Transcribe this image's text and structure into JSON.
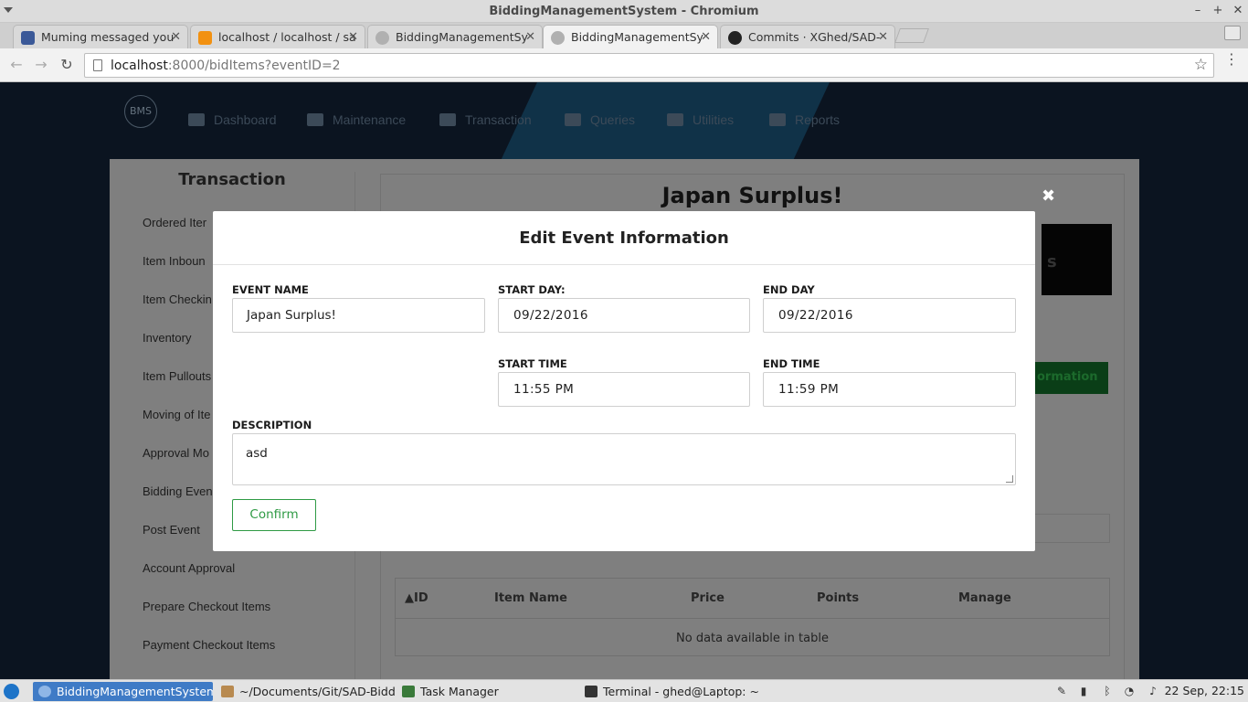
{
  "window": {
    "title": "BiddingManagementSystem - Chromium",
    "minimize": "–",
    "maximize": "+",
    "close": "✕"
  },
  "tabs": [
    {
      "label": "Muming messaged you",
      "icon": "facebook-icon",
      "color": "#3b5998"
    },
    {
      "label": "localhost / localhost / sa",
      "icon": "phpmyadmin-icon",
      "color": "#f29111"
    },
    {
      "label": "BiddingManagementSy",
      "icon": "globe-icon",
      "color": "#9a9a9a"
    },
    {
      "label": "BiddingManagementSy",
      "icon": "globe-icon",
      "color": "#9a9a9a"
    },
    {
      "label": "Commits · XGhed/SAD-",
      "icon": "github-icon",
      "color": "#222222"
    }
  ],
  "toolbar": {
    "back": "←",
    "forward": "→",
    "reload": "↻",
    "url_host": "localhost",
    "url_rest": ":8000/bidItems?eventID=2",
    "star": "☆",
    "menu": "⋮"
  },
  "app": {
    "logo_text": "BMS",
    "nav": [
      "Dashboard",
      "Maintenance",
      "Transaction",
      "Queries",
      "Utilities",
      "Reports"
    ],
    "sidebar_title": "Transaction",
    "sidebar_items": [
      "Ordered Iter",
      "Item Inboun",
      "Item Checkin",
      "Inventory",
      "Item Pullouts",
      "Moving of Ite",
      "Approval Mo",
      "Bidding Even",
      "Post Event",
      "Account Approval",
      "Prepare Checkout Items",
      "Payment Checkout Items"
    ],
    "event_title": "Japan Surplus!",
    "banner_text": "s",
    "green_button": "ormation",
    "table_headers": [
      "▲ID",
      "Item Name",
      "Price",
      "Points",
      "Manage"
    ],
    "table_empty": "No data available in table"
  },
  "modal": {
    "close": "✖",
    "title": "Edit Event Information",
    "event_name_label": "EVENT NAME",
    "event_name_value": "Japan Surplus!",
    "start_day_label": "START DAY:",
    "start_day_value": "09/22/2016",
    "end_day_label": "END DAY",
    "end_day_value": "09/22/2016",
    "start_time_label": "START TIME",
    "start_time_value": "11:55 PM",
    "end_time_label": "END TIME",
    "end_time_value": "11:59 PM",
    "description_label": "DESCRIPTION",
    "description_value": "asd",
    "confirm_label": "Confirm"
  },
  "taskbar": {
    "tasks": [
      "BiddingManagementSystem...",
      "~/Documents/Git/SAD-Biddi...",
      "Task Manager",
      "Terminal - ghed@Laptop: ~/..."
    ],
    "clock": "22 Sep, 22:15"
  }
}
